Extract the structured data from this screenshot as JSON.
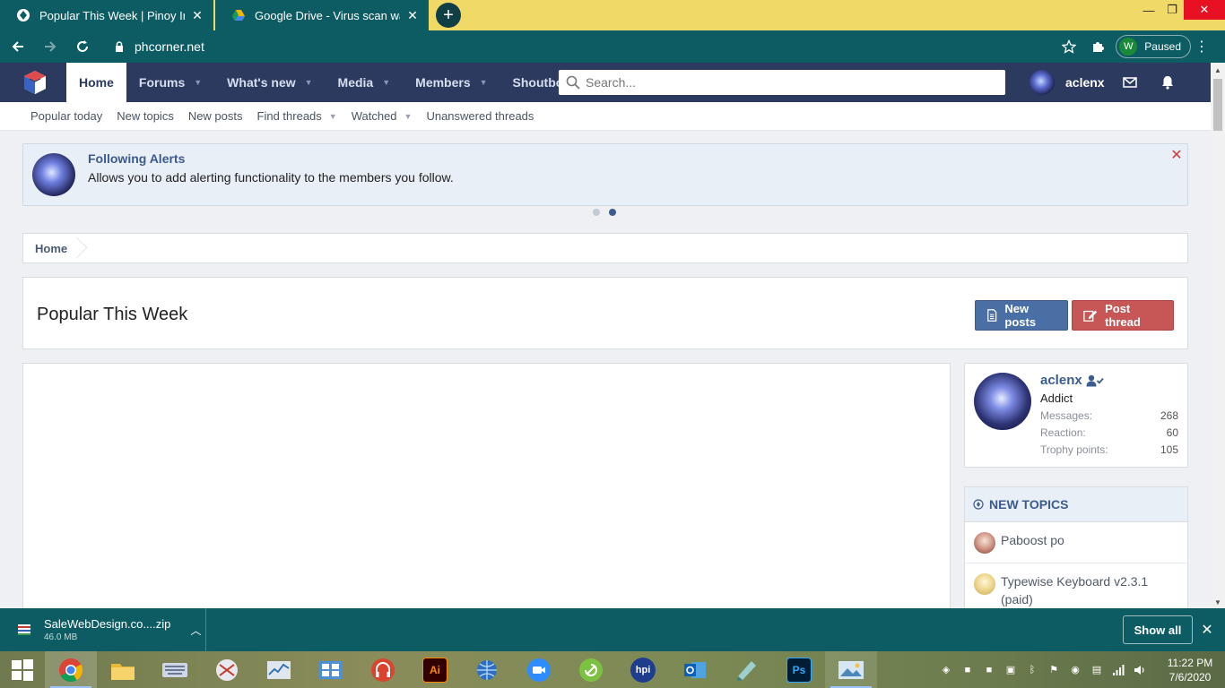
{
  "browser": {
    "tabs": [
      {
        "title": "Popular This Week | Pinoy Internet",
        "active": true
      },
      {
        "title": "Google Drive - Virus scan warning",
        "active": false
      }
    ],
    "url": "phcorner.net",
    "profile_initial": "W",
    "profile_status": "Paused"
  },
  "site": {
    "nav": [
      {
        "label": "Home",
        "selected": true,
        "caret": false
      },
      {
        "label": "Forums",
        "caret": true
      },
      {
        "label": "What's new",
        "caret": true
      },
      {
        "label": "Media",
        "caret": true
      },
      {
        "label": "Members",
        "caret": true
      },
      {
        "label": "Shoutbox",
        "caret": false
      }
    ],
    "search_placeholder": "Search...",
    "username": "aclenx",
    "subnav": [
      {
        "label": "Popular today",
        "caret": false
      },
      {
        "label": "New topics",
        "caret": false
      },
      {
        "label": "New posts",
        "caret": false
      },
      {
        "label": "Find threads",
        "caret": true
      },
      {
        "label": "Watched",
        "caret": true
      },
      {
        "label": "Unanswered threads",
        "caret": false
      }
    ]
  },
  "notice": {
    "title": "Following Alerts",
    "text": "Allows you to add alerting functionality to the members you follow.",
    "active_dot": 2,
    "dot_count": 2
  },
  "breadcrumb": [
    "Home"
  ],
  "page": {
    "title": "Popular This Week",
    "new_posts_label": "New posts",
    "post_thread_label": "Post thread"
  },
  "sidebar": {
    "user": {
      "name": "aclenx",
      "title": "Addict",
      "stats": [
        {
          "label": "Messages:",
          "value": "268"
        },
        {
          "label": "Reaction:",
          "value": "60"
        },
        {
          "label": "Trophy points:",
          "value": "105"
        }
      ]
    },
    "new_topics": {
      "heading": "NEW TOPICS",
      "items": [
        "Paboost po",
        "Typewise Keyboard v2.3.1 (paid)"
      ]
    }
  },
  "downloads": {
    "file_name": "SaleWebDesign.co....zip",
    "file_size": "46.0 MB",
    "show_all_label": "Show all"
  },
  "taskbar": {
    "time": "11:22 PM",
    "date": "7/6/2020"
  },
  "colors": {
    "browser_chrome": "#0e5c63",
    "tab_strip": "#f0d966",
    "site_header": "#2b3a5e",
    "link_blue": "#3d5c8e",
    "button_blue": "#4a6fa5",
    "button_red": "#c75757"
  }
}
